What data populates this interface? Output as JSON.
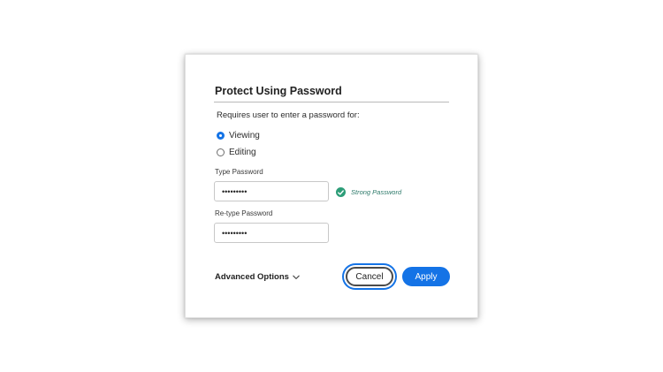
{
  "dialog": {
    "title": "Protect Using Password",
    "intro": "Requires user to enter a password for:",
    "radio_options": [
      {
        "label": "Viewing",
        "selected": true
      },
      {
        "label": "Editing",
        "selected": false
      }
    ],
    "type_password": {
      "label": "Type Password",
      "value": "•••••••••"
    },
    "strength": {
      "text": "Strong Password",
      "icon": "checkmark-circle-icon",
      "color": "#2d9d78"
    },
    "retype_password": {
      "label": "Re-type Password",
      "value": "•••••••••"
    },
    "advanced_label": "Advanced Options",
    "cancel_label": "Cancel",
    "apply_label": "Apply",
    "accent_color": "#1473e6"
  }
}
